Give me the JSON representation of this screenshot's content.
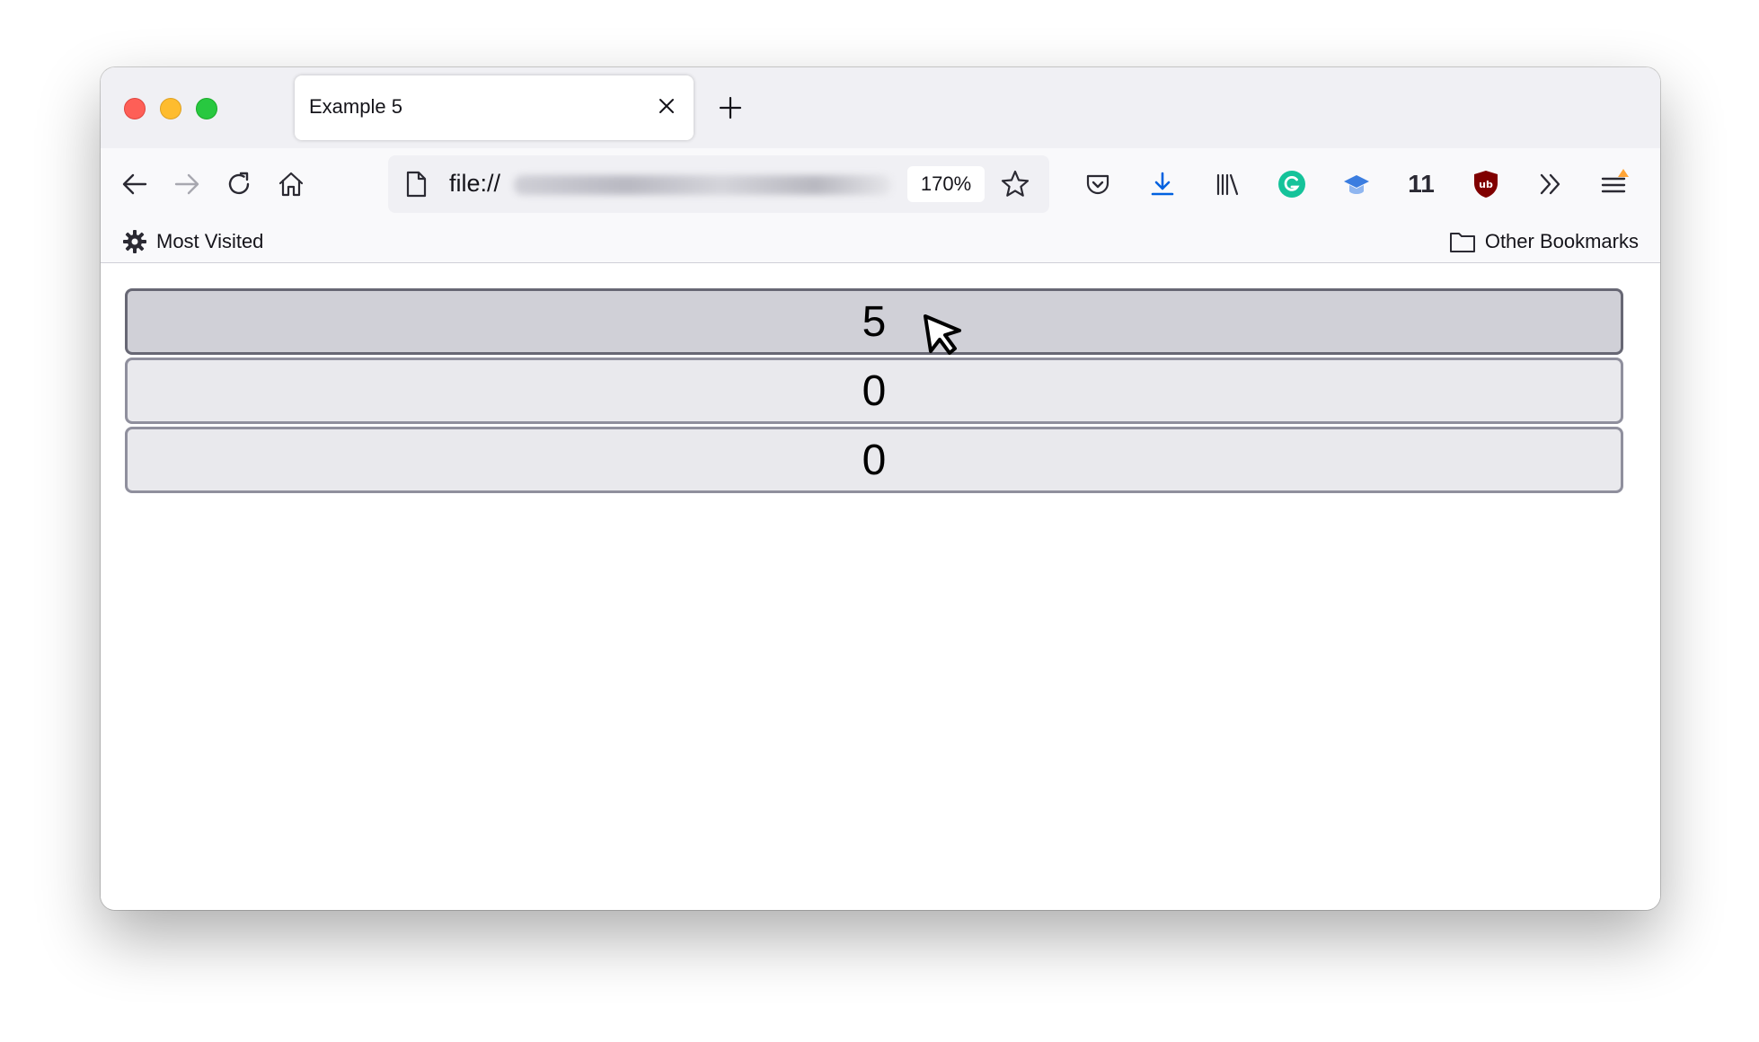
{
  "browser": {
    "tab": {
      "title": "Example 5"
    },
    "url": {
      "prefix": "file://",
      "zoom": "170%"
    },
    "extensions": {
      "count_badge": "11"
    },
    "bookmarks": {
      "left_label": "Most Visited",
      "right_label": "Other Bookmarks"
    }
  },
  "icons": {
    "tab_close": "close-icon",
    "new_tab": "plus-icon",
    "back": "arrow-left-icon",
    "forward": "arrow-right-icon",
    "reload": "reload-icon",
    "home": "home-icon",
    "page": "page-icon",
    "bookmark_star": "star-icon",
    "pocket": "pocket-icon",
    "downloads": "download-icon",
    "library": "library-icon",
    "grammarly": "grammarly-icon",
    "graduation": "graduation-cap-icon",
    "ublock": "ublock-icon",
    "overflow": "chevrons-right-icon",
    "menu": "hamburger-menu-icon",
    "most_visited": "gear-icon",
    "other_bookmarks": "folder-icon",
    "cursor": "mouse-cursor-icon"
  },
  "colors": {
    "close_red": "#fe5f57",
    "minimize_yellow": "#febc2e",
    "zoom_green": "#28c840",
    "download_blue": "#0061e0",
    "grammarly_green": "#15c39a",
    "ublock_red": "#800000",
    "update_badge_orange": "#ffa436"
  },
  "page": {
    "counters": [
      {
        "value": "5",
        "state": "hover"
      },
      {
        "value": "0",
        "state": "normal"
      },
      {
        "value": "0",
        "state": "normal"
      }
    ]
  }
}
